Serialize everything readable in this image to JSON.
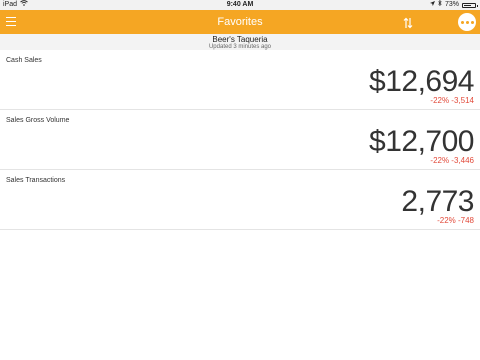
{
  "status_bar": {
    "device": "iPad",
    "time": "9:40 AM",
    "battery": "73%",
    "battery_level": 0.73
  },
  "nav": {
    "title": "Favorites",
    "menu_icon": "hamburger-icon",
    "sort_icon": "sort-arrows-icon",
    "more_icon": "more-dots-icon",
    "accent_color": "#f5a623"
  },
  "header": {
    "business_name": "Beer's Taqueria",
    "updated": "Updated 3 minutes ago"
  },
  "cards": [
    {
      "label": "Cash Sales",
      "value": "$12,694",
      "delta": "-22% -3,514"
    },
    {
      "label": "Sales Gross Volume",
      "value": "$12,700",
      "delta": "-22% -3,446"
    },
    {
      "label": "Sales Transactions",
      "value": "2,773",
      "delta": "-22% -748"
    }
  ],
  "colors": {
    "negative": "#e24a3a"
  }
}
